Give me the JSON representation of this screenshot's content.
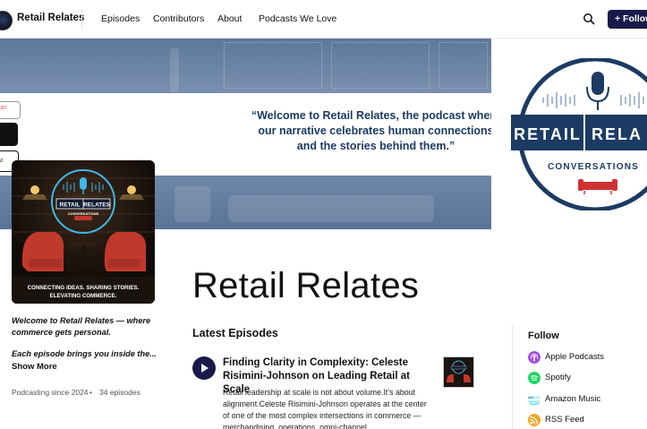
{
  "nav": {
    "site_title": "Retail Relates",
    "links": [
      "Episodes",
      "Contributors",
      "About",
      "Podcasts We Love"
    ],
    "follow_button": "+ Follow"
  },
  "banner": {
    "quote": "“Welcome to Retail Relates, the podcast where our narrative celebrates human connections and the stories behind them.”"
  },
  "side_badges": {
    "badge_a": "CAST",
    "badge_c": "cast"
  },
  "cover": {
    "brand_left": "RETAIL",
    "brand_right": "RELATES",
    "brand_sub": "CONVERSATIONS",
    "tagline_line1": "CONNECTING IDEAS. SHARING STORIES.",
    "tagline_line2": "ELEVATING COMMERCE."
  },
  "right_logo": {
    "word_left": "RETAIL",
    "word_right": "RELA",
    "sub": "CONVERSATIONS"
  },
  "podcast": {
    "title": "Retail Relates",
    "description_line1": "Welcome to Retail Relates — where commerce gets personal.",
    "description_line2": "Each episode brings you inside the...",
    "show_more": "Show More",
    "since": "Podcasting since 2024",
    "episode_count": "34 episodes"
  },
  "latest": {
    "heading": "Latest Episodes",
    "episodes": [
      {
        "title": "Finding Clarity in Complexity: Celeste Risimini-Johnson on Leading Retail at Scale",
        "description": "Retail leadership at scale is not about volume.It’s about alignment.Celeste Risimini-Johnson operates at the center of one of the most complex intersections in commerce — merchandising, operations, omni-channel"
      }
    ]
  },
  "follow": {
    "heading": "Follow",
    "items": [
      {
        "label": "Apple Podcasts",
        "icon": "apple-podcasts-icon",
        "color": "#a24be0"
      },
      {
        "label": "Spotify",
        "icon": "spotify-icon",
        "color": "#1ed760"
      },
      {
        "label": "Amazon Music",
        "icon": "amazon-music-icon",
        "color": "#25d1da"
      },
      {
        "label": "RSS Feed",
        "icon": "rss-icon",
        "color": "#f5a623"
      }
    ]
  },
  "colors": {
    "accent": "#1a1a4a",
    "quote": "#1c3b63",
    "banner": "#6d85a6"
  }
}
